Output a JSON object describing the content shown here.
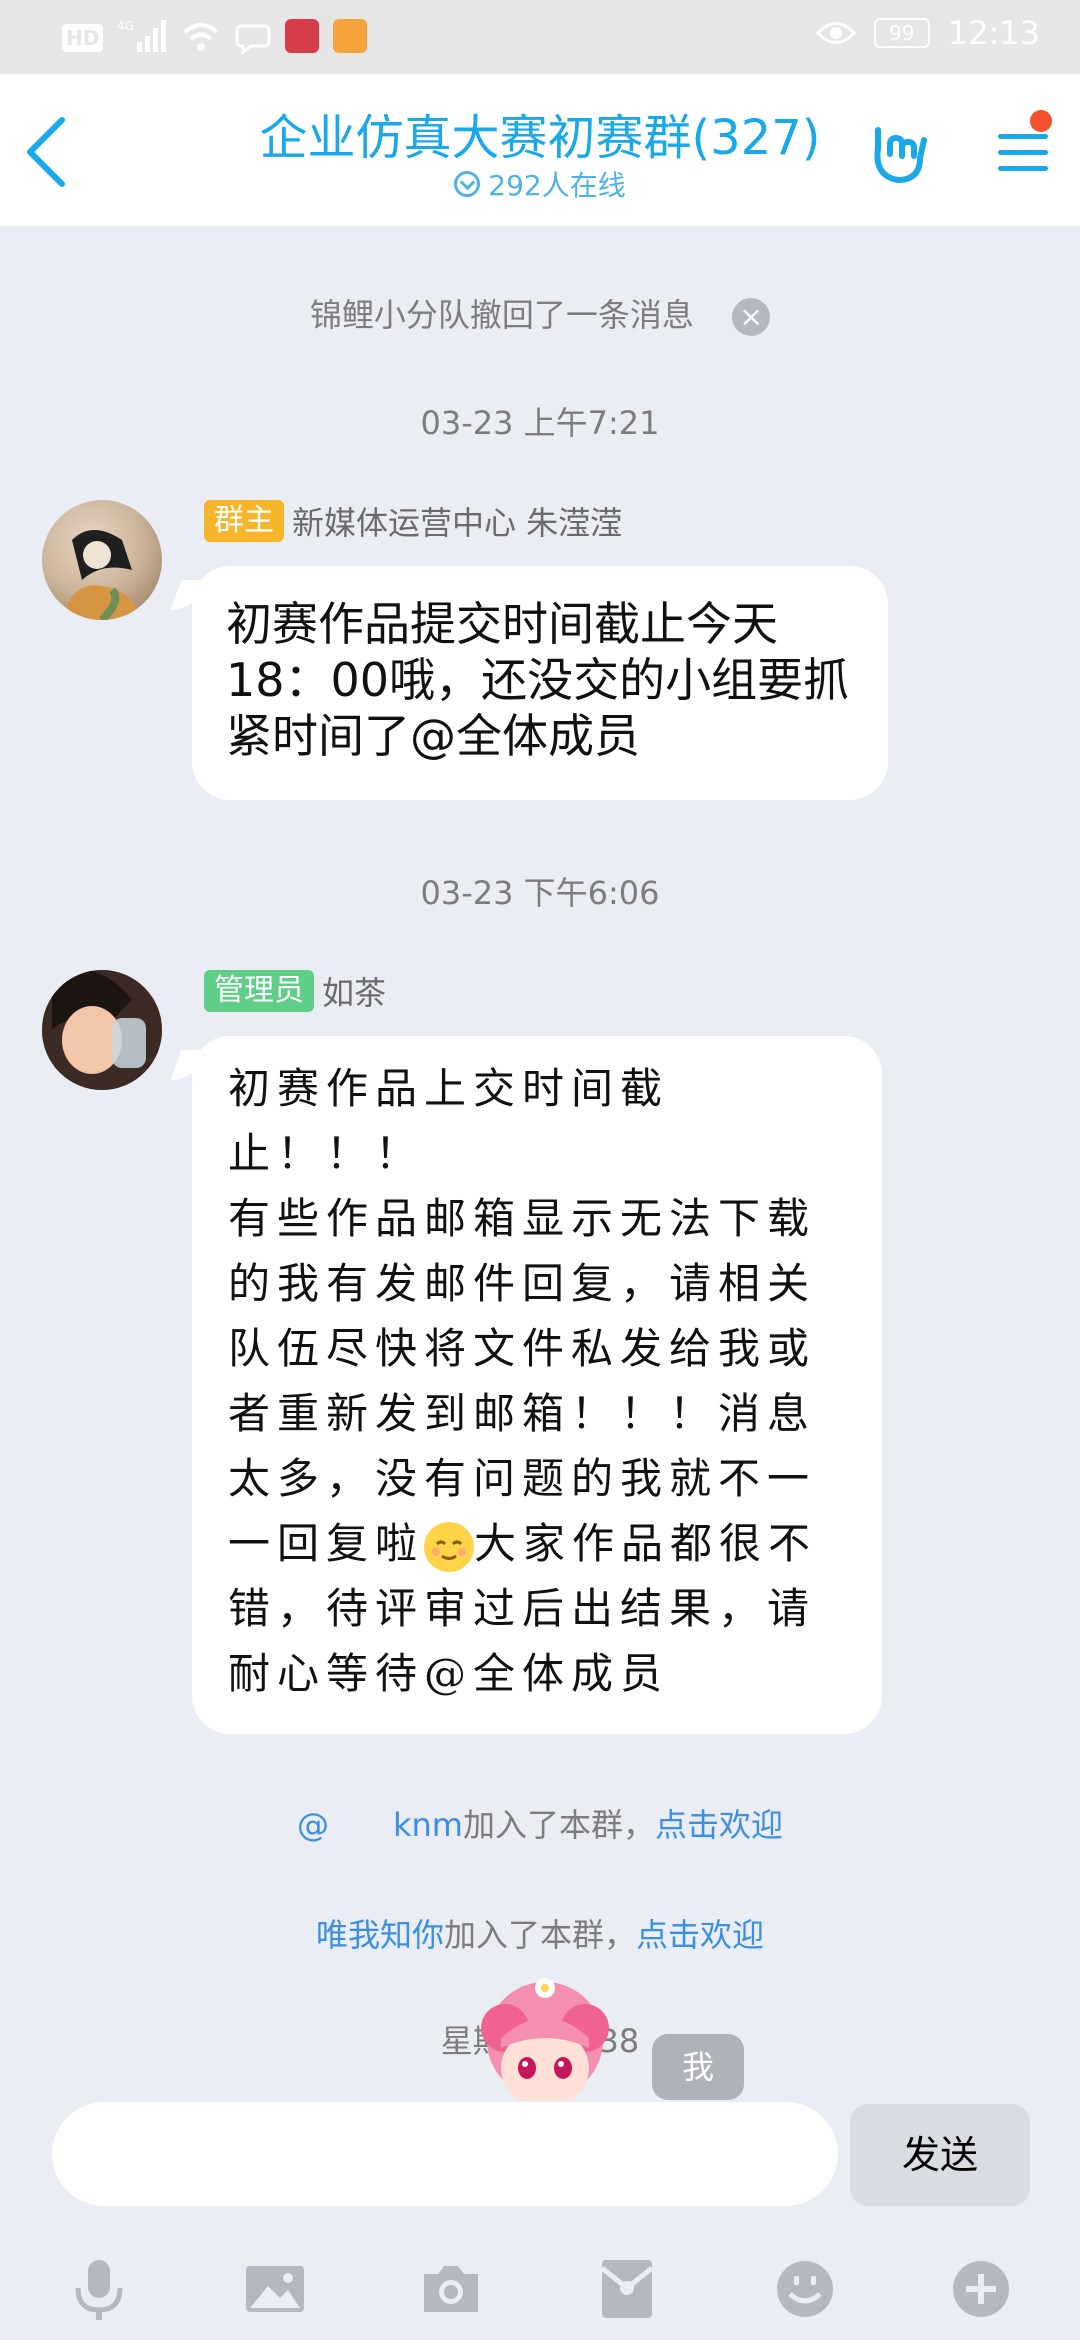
{
  "status_bar": {
    "left_icons": [
      "HD",
      "4G-signal-icon",
      "wifi-icon",
      "chat-bubble-icon",
      "red-app-icon",
      "orange-app-icon"
    ],
    "hd": "HD",
    "battery": "99",
    "time": "12:13"
  },
  "header": {
    "title": "企业仿真大赛初赛群(327)",
    "online": "292人在线"
  },
  "messages": {
    "recall": "锦鲤小分队撤回了一条消息",
    "recall_close": "×",
    "time1": "03-23 上午7:21",
    "msg1": {
      "badge": "群主",
      "sender": "新媒体运营中心 朱滢滢",
      "text": "初赛作品提交时间截止今天18：00哦，还没交的小组要抓紧时间了@全体成员"
    },
    "time2": "03-23 下午6:06",
    "msg2": {
      "badge": "管理员",
      "sender": "如茶",
      "text_before_emoji": "初赛作品上交时间截止！！！\n有些作品邮箱显示无法下载的我有发邮件回复，请相关队伍尽快将文件私发给我或者重新发到邮箱！！！消息太多，没有问题的我就不一一回复啦",
      "text_after_emoji": "大家作品都很不错，待评审过后出结果，请耐心等待@全体成员"
    },
    "join1": {
      "name": "@　　knm",
      "text": "加入了本群，",
      "link": "点击欢迎"
    },
    "join2": {
      "name": "唯我知你",
      "text": "加入了本群，",
      "link": "点击欢迎"
    },
    "time3": "星期二 10:38",
    "me_badge": "我"
  },
  "input": {
    "placeholder": "",
    "send": "发送"
  },
  "toolbar": [
    "microphone-icon",
    "image-icon",
    "camera-icon",
    "red-packet-icon",
    "emoji-icon",
    "plus-icon"
  ],
  "colors": {
    "accent": "#19a8e9",
    "background": "#eaedf4",
    "owner_badge": "#f7b52c",
    "admin_badge": "#5fcf88",
    "link": "#3c8fe0"
  }
}
